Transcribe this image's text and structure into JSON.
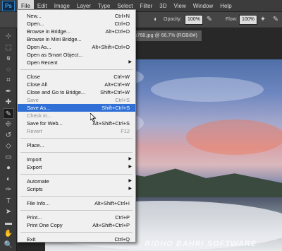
{
  "app": {
    "logo": "Ps"
  },
  "menubar": {
    "items": [
      "File",
      "Edit",
      "Image",
      "Layer",
      "Type",
      "Select",
      "Filter",
      "3D",
      "View",
      "Window",
      "Help"
    ],
    "active": "File"
  },
  "options": {
    "opacity_label": "Opacity:",
    "opacity_value": "100%",
    "flow_label": "Flow:",
    "flow_value": "100%"
  },
  "document": {
    "tab_label": "x768.jpg @ 66.7% (RGB/8#)"
  },
  "file_menu": {
    "items": [
      {
        "label": "New...",
        "shortcut": "Ctrl+N"
      },
      {
        "label": "Open...",
        "shortcut": "Ctrl+O"
      },
      {
        "label": "Browse in Bridge...",
        "shortcut": "Alt+Ctrl+O"
      },
      {
        "label": "Browse in Mini Bridge...",
        "shortcut": ""
      },
      {
        "label": "Open As...",
        "shortcut": "Alt+Shift+Ctrl+O"
      },
      {
        "label": "Open as Smart Object...",
        "shortcut": ""
      },
      {
        "label": "Open Recent",
        "shortcut": "",
        "submenu": true
      },
      {
        "label": "Close",
        "shortcut": "Ctrl+W"
      },
      {
        "label": "Close All",
        "shortcut": "Alt+Ctrl+W"
      },
      {
        "label": "Close and Go to Bridge...",
        "shortcut": "Shift+Ctrl+W"
      },
      {
        "label": "Save",
        "shortcut": "Ctrl+S",
        "disabled": true
      },
      {
        "label": "Save As...",
        "shortcut": "Shift+Ctrl+S",
        "highlight": true
      },
      {
        "label": "Check In...",
        "shortcut": "",
        "disabled": true
      },
      {
        "label": "Save for Web...",
        "shortcut": "Alt+Shift+Ctrl+S"
      },
      {
        "label": "Revert",
        "shortcut": "F12",
        "disabled": true
      },
      {
        "label": "Place...",
        "shortcut": ""
      },
      {
        "label": "Import",
        "shortcut": "",
        "submenu": true
      },
      {
        "label": "Export",
        "shortcut": "",
        "submenu": true
      },
      {
        "label": "Automate",
        "shortcut": "",
        "submenu": true
      },
      {
        "label": "Scripts",
        "shortcut": "",
        "submenu": true
      },
      {
        "label": "File Info...",
        "shortcut": "Alt+Shift+Ctrl+I"
      },
      {
        "label": "Print...",
        "shortcut": "Ctrl+P"
      },
      {
        "label": "Print One Copy",
        "shortcut": "Alt+Shift+Ctrl+P"
      },
      {
        "label": "Exit",
        "shortcut": "Ctrl+Q"
      }
    ]
  },
  "watermark": "RIDHO BAHRI SOFTWARE",
  "tools": [
    "move-tool-icon",
    "marquee-tool-icon",
    "lasso-tool-icon",
    "quick-select-tool-icon",
    "crop-tool-icon",
    "eyedropper-tool-icon",
    "healing-tool-icon",
    "brush-tool-icon",
    "clone-stamp-tool-icon",
    "history-brush-tool-icon",
    "eraser-tool-icon",
    "gradient-tool-icon",
    "blur-tool-icon",
    "dodge-tool-icon",
    "pen-tool-icon",
    "type-tool-icon",
    "path-select-tool-icon",
    "shape-tool-icon",
    "hand-tool-icon",
    "zoom-tool-icon"
  ],
  "colors": {
    "highlight": "#2f6fd6",
    "menu_bg": "#f0f0f0",
    "chrome": "#3c3c3c"
  }
}
